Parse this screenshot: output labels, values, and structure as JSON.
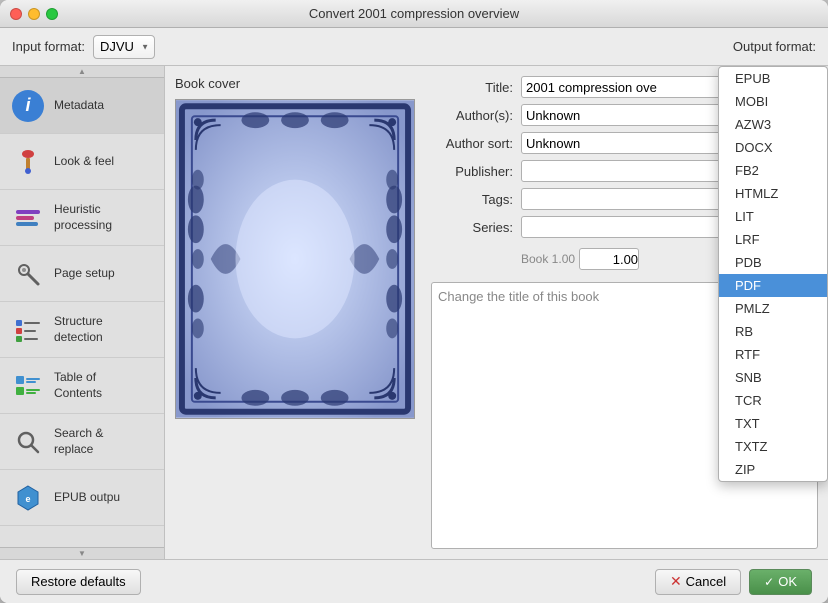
{
  "window": {
    "title": "Convert 2001 compression overview"
  },
  "toolbar": {
    "input_format_label": "Input format:",
    "input_format_value": "DJVU",
    "output_format_label": "Output format:",
    "restore_defaults_label": "Restore defaults",
    "cancel_label": "Cancel",
    "ok_label": "OK"
  },
  "sidebar": {
    "items": [
      {
        "id": "metadata",
        "label": "Metadata",
        "icon": "info-icon"
      },
      {
        "id": "look-feel",
        "label": "Look & feel",
        "icon": "brush-icon"
      },
      {
        "id": "heuristic",
        "label": "Heuristic\nprocessing",
        "icon": "gear-icon"
      },
      {
        "id": "page-setup",
        "label": "Page setup",
        "icon": "wrench-icon"
      },
      {
        "id": "structure",
        "label": "Structure\ndetection",
        "icon": "list-icon"
      },
      {
        "id": "toc",
        "label": "Table of\nContents",
        "icon": "toc-icon"
      },
      {
        "id": "search-replace",
        "label": "Search &\nreplace",
        "icon": "search-icon"
      },
      {
        "id": "epub-output",
        "label": "EPUB outpu",
        "icon": "epub-icon"
      }
    ]
  },
  "metadata": {
    "book_cover_label": "Book cover",
    "fields": [
      {
        "label": "Title:",
        "value": "2001 compression ove",
        "name": "title-field"
      },
      {
        "label": "Author(s):",
        "value": "Unknown",
        "name": "authors-field"
      },
      {
        "label": "Author sort:",
        "value": "Unknown",
        "name": "author-sort-field"
      },
      {
        "label": "Publisher:",
        "value": "",
        "name": "publisher-field"
      },
      {
        "label": "Tags:",
        "value": "",
        "name": "tags-field"
      },
      {
        "label": "Series:",
        "value": "",
        "name": "series-field"
      }
    ],
    "book_number": "Book 1.00",
    "description_placeholder": "Change the title of this book"
  },
  "output_format": {
    "options": [
      "EPUB",
      "MOBI",
      "AZW3",
      "DOCX",
      "FB2",
      "HTMLZ",
      "LIT",
      "LRF",
      "PDB",
      "PDF",
      "PMLZ",
      "RB",
      "RTF",
      "SNB",
      "TCR",
      "TXT",
      "TXTZ",
      "ZIP"
    ],
    "selected": "PDF"
  }
}
